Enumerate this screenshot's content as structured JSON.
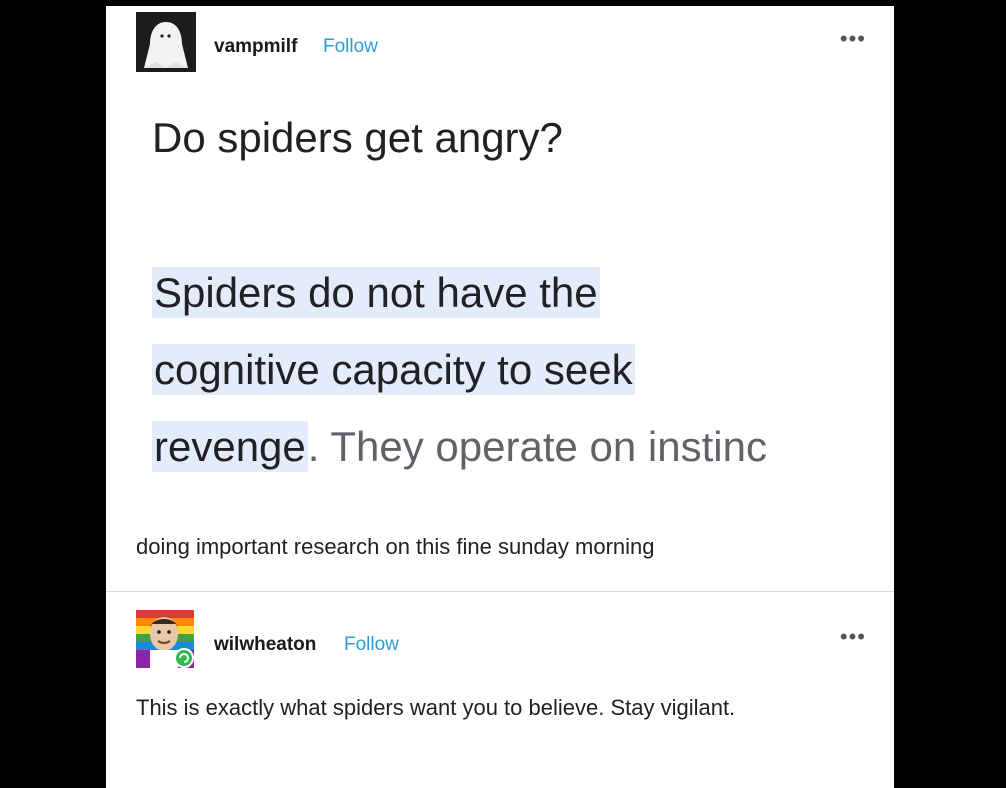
{
  "post": {
    "username": "vampmilf",
    "follow_label": "Follow",
    "more_label": "•••",
    "question": "Do spiders get angry?",
    "answer_lines": [
      {
        "highlight": "Spiders do not have the",
        "rest": ""
      },
      {
        "highlight": "cognitive capacity to seek",
        "rest": ""
      },
      {
        "highlight": "revenge",
        "rest": ". They operate on instinc"
      }
    ],
    "caption": "doing important research on this fine sunday morning"
  },
  "reblog": {
    "username": "wilwheaton",
    "follow_label": "Follow",
    "more_label": "•••",
    "text": "This is exactly what spiders want you to believe. Stay vigilant."
  },
  "colors": {
    "follow": "#2f9bd6",
    "highlight": "#e4ecfb",
    "background": "#000000",
    "card": "#ffffff"
  },
  "icons": {
    "avatar1": "ghost-avatar-icon",
    "avatar2": "rainbow-portrait-avatar-icon",
    "more": "more-dots-icon"
  }
}
